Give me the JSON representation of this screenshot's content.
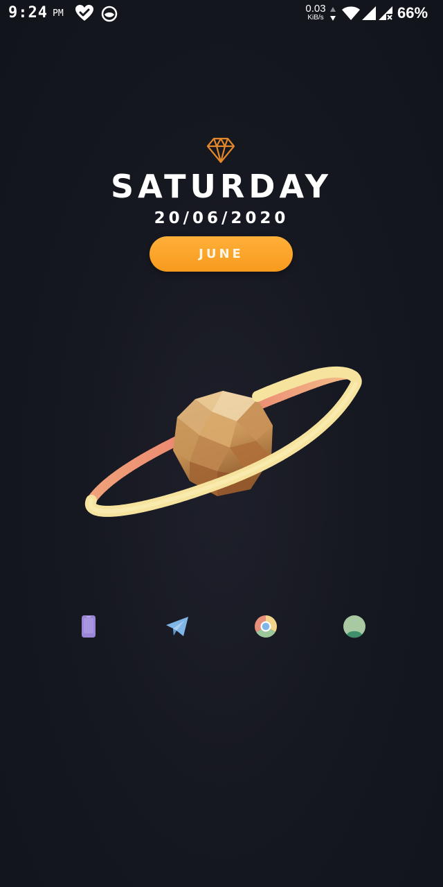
{
  "status_bar": {
    "time": "9:24",
    "ampm": "PM",
    "net_speed_value": "0.03",
    "net_speed_unit": "KiB/s",
    "battery": "66%",
    "icons": [
      "heart-check-icon",
      "face-app-icon",
      "data-arrows-icon",
      "wifi-icon",
      "signal-icon",
      "signal-no-data-icon"
    ]
  },
  "date_widget": {
    "icon": "diamond-icon",
    "day": "SATURDAY",
    "date": "20/06/2020",
    "month": "JUNE"
  },
  "wallpaper": {
    "art": "ringed-planet",
    "colors": {
      "planet": "#c9955a",
      "ring": "#f5e29a",
      "ring_back": "#ea8270",
      "background": "#161821"
    }
  },
  "dock": {
    "apps": [
      {
        "icon": "phone-icon",
        "color": "#9a86d6"
      },
      {
        "icon": "telegram-icon",
        "color": "#7fb6e6"
      },
      {
        "icon": "chrome-icon",
        "color": "#e88f7c"
      },
      {
        "icon": "contacts-icon",
        "color": "#a9c9a3"
      }
    ]
  },
  "accent_color": "#f79a1d"
}
